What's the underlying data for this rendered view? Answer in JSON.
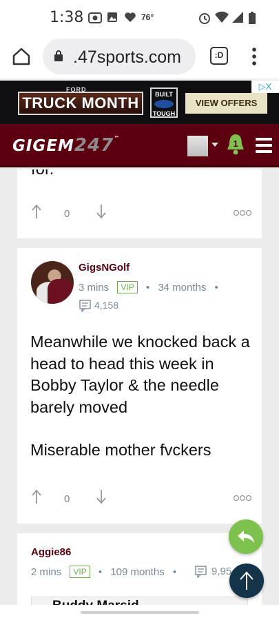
{
  "status_bar": {
    "time": "1:38",
    "temperature": "76°"
  },
  "browser": {
    "url": ".47sports.com",
    "tab_count": ":D"
  },
  "ad": {
    "brand": "FORD",
    "title": "TRUCK MONTH",
    "badge_line1": "BUILT",
    "badge_line2": "TOUGH",
    "cta": "VIEW OFFERS",
    "ad_marker": "▷X"
  },
  "site": {
    "logo_text": "GIGEM",
    "logo_number": "247",
    "logo_tm": "™",
    "notification_count": "1"
  },
  "posts": [
    {
      "truncated_text": "for.",
      "votes": "0"
    },
    {
      "username": "GigsNGolf",
      "time_ago": "3 mins",
      "badge": "VIP",
      "tenure": "34 months",
      "post_count": "4,158",
      "paragraphs": [
        "Meanwhile we knocked back a head to head this week in Bobby Taylor & the needle barely moved",
        "Miserable mother fvckers"
      ],
      "votes": "0"
    },
    {
      "username": "Aggie86",
      "time_ago": "2 mins",
      "badge": "VIP",
      "tenure": "109 months",
      "post_count": "9,95",
      "quote_preview": "Buddy Marsid..."
    }
  ],
  "colors": {
    "brand_maroon": "#5c0010",
    "reply_green": "#7dc24d",
    "scroll_top_navy": "#14344a",
    "vip_green": "#6ab04c"
  }
}
